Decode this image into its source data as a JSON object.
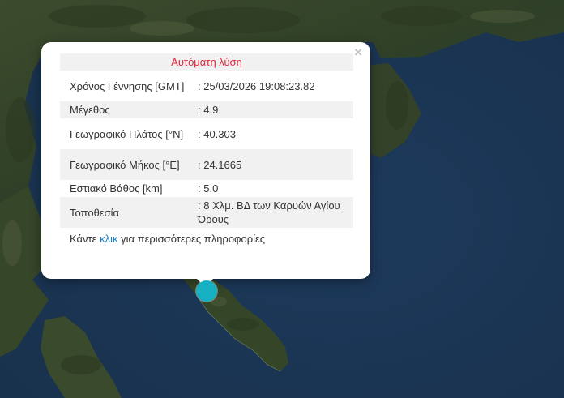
{
  "popup": {
    "title": "Αυτόματη λύση",
    "close_symbol": "×",
    "rows": [
      {
        "label": "Χρόνος Γέννησης [GMT]",
        "value": ": 25/03/2026 19:08:23.82"
      },
      {
        "label": "Μέγεθος",
        "value": ": 4.9"
      },
      {
        "label": "Γεωγραφικό Πλάτος [°N]",
        "value": ": 40.303"
      },
      {
        "label": "Γεωγραφικό Μήκος [°E]",
        "value": ": 24.1665"
      },
      {
        "label": "Εστιακό Βάθος [km]",
        "value": ": 5.0"
      },
      {
        "label": "Τοποθεσία",
        "value": ": 8 Χλμ. ΒΔ των Καρυών Αγίου Όρους"
      }
    ],
    "footer": {
      "before": "Κάντε ",
      "link": "κλικ",
      "after": " για περισσότερες πληροφορίες"
    }
  },
  "colors": {
    "sea": "#1b3350",
    "land": "#35432a",
    "marker": "#17b0c3",
    "title": "#e0243a",
    "link": "#1f7fbf"
  },
  "icons": {
    "close": "close-icon",
    "marker": "epicenter-marker"
  }
}
